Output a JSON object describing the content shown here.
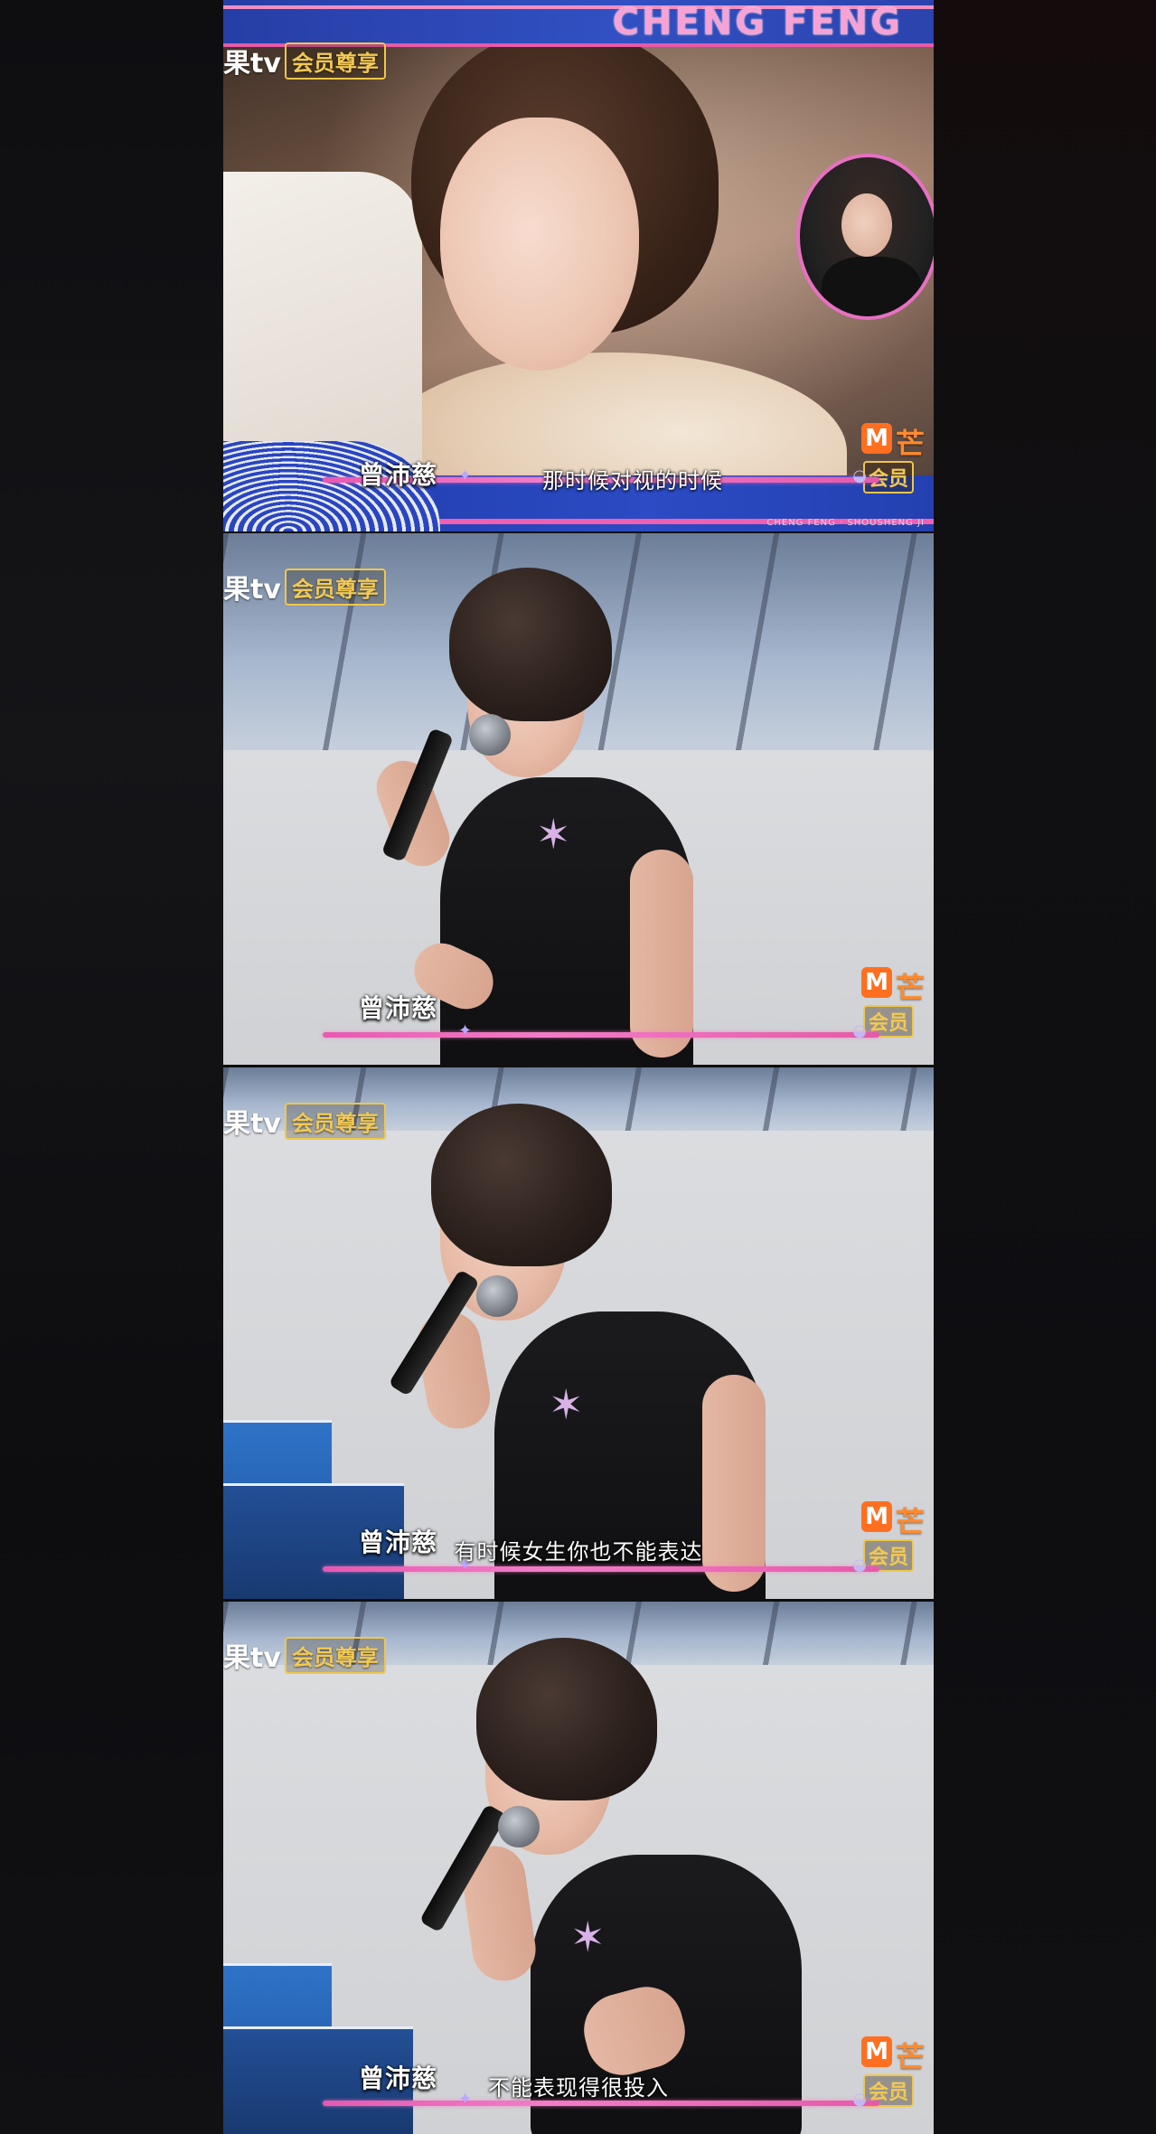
{
  "frames": [
    {
      "banner_title": "CHENG FENG",
      "speaker": "曾沛慈",
      "subtitle": "那时候对视的时候",
      "credits": "CHENG FENG · SHOUSHENG JI"
    },
    {
      "speaker": "曾沛慈",
      "subtitle": ""
    },
    {
      "speaker": "曾沛慈",
      "subtitle": "有时候女生你也不能表达"
    },
    {
      "speaker": "曾沛慈",
      "subtitle": "不能表现得很投入"
    }
  ],
  "watermark_tl": {
    "tv": "果tv",
    "vip": "会员尊享"
  },
  "watermark_br": {
    "m": "M",
    "brand": "芒",
    "vip": "会员"
  },
  "colors": {
    "accent_pink": "#e759b1",
    "banner_blue": "#2c4bc4",
    "vip_gold": "#f3c953",
    "brand_orange": "#ff6f1f"
  }
}
